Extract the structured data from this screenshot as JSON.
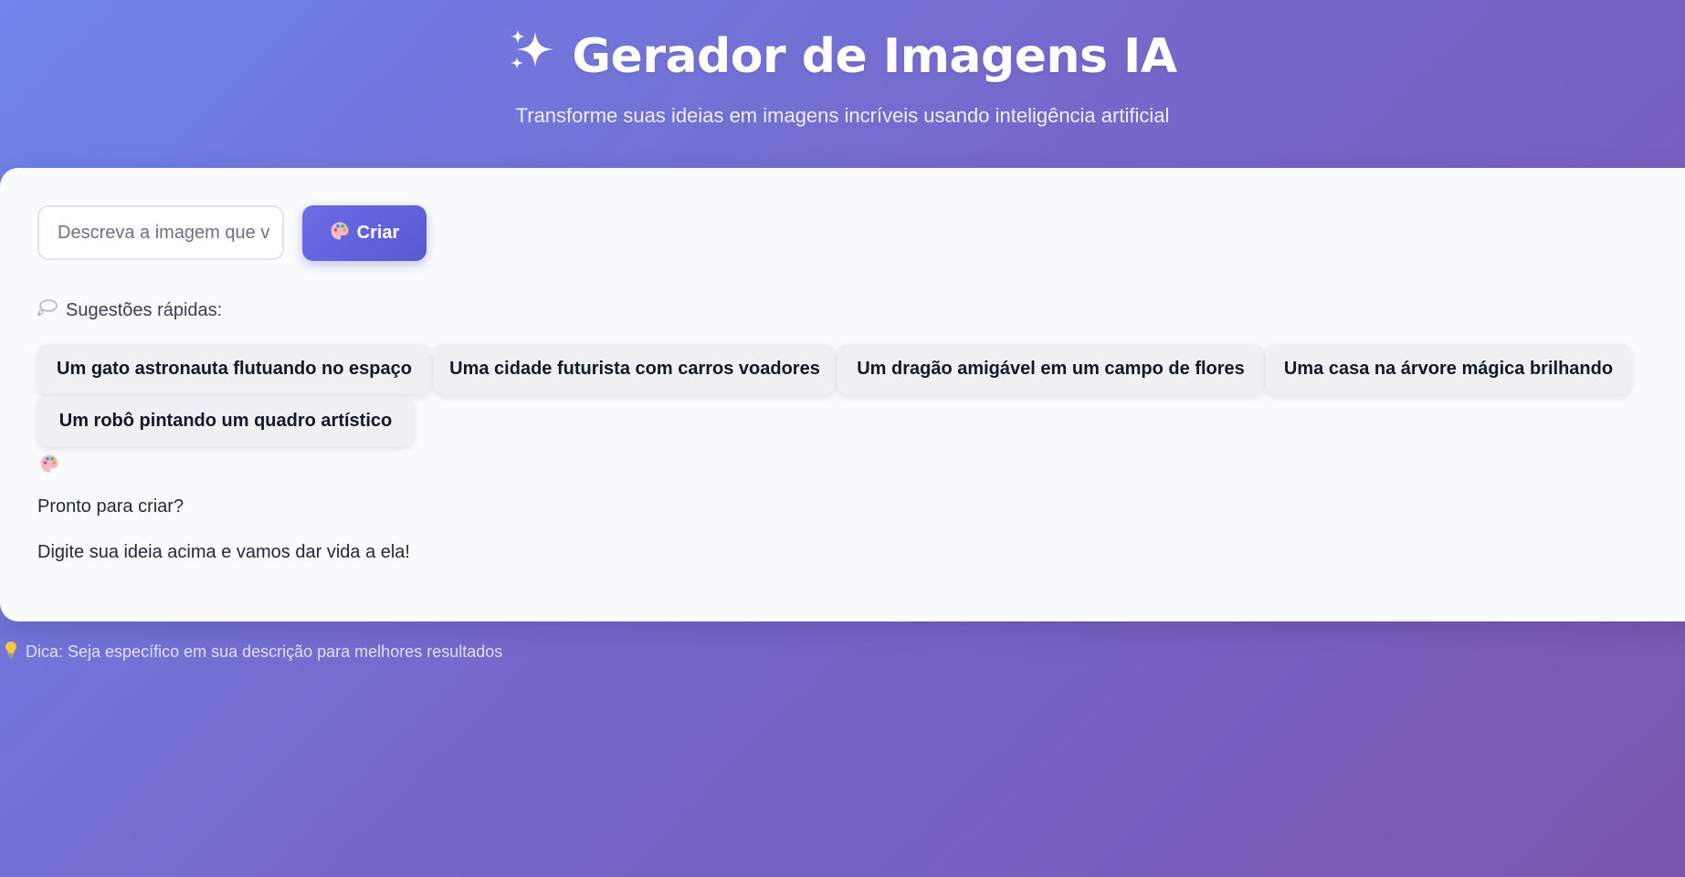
{
  "header": {
    "title": "Gerador de Imagens IA",
    "title_icon": "sparkles-icon",
    "subtitle": "Transforme suas ideias em imagens incríveis usando inteligência artificial"
  },
  "form": {
    "input_placeholder": "Descreva a imagem que v",
    "create_label": "Criar",
    "create_icon": "palette-icon"
  },
  "suggestions": {
    "label": "Sugestões rápidas:",
    "label_icon": "thought-bubble-icon",
    "items": [
      "Um gato astronauta flutuando no espaço",
      "Uma cidade futurista com carros voadores",
      "Um dragão amigável em um campo de flores",
      "Uma casa na árvore mágica brilhando",
      "Um robô pintando um quadro artístico"
    ]
  },
  "empty_state": {
    "icon": "palette-icon",
    "title": "Pronto para criar?",
    "message": "Digite sua ideia acima e vamos dar vida a ela!"
  },
  "footer": {
    "tip_icon": "lightbulb-icon",
    "tip": "Dica: Seja específico em sua descrição para melhores resultados"
  },
  "colors": {
    "background_start": "#6e84ea",
    "background_end": "#7a57b0",
    "button": "#5f60db",
    "card": "#fafbfc",
    "chip": "#eff0f3"
  }
}
